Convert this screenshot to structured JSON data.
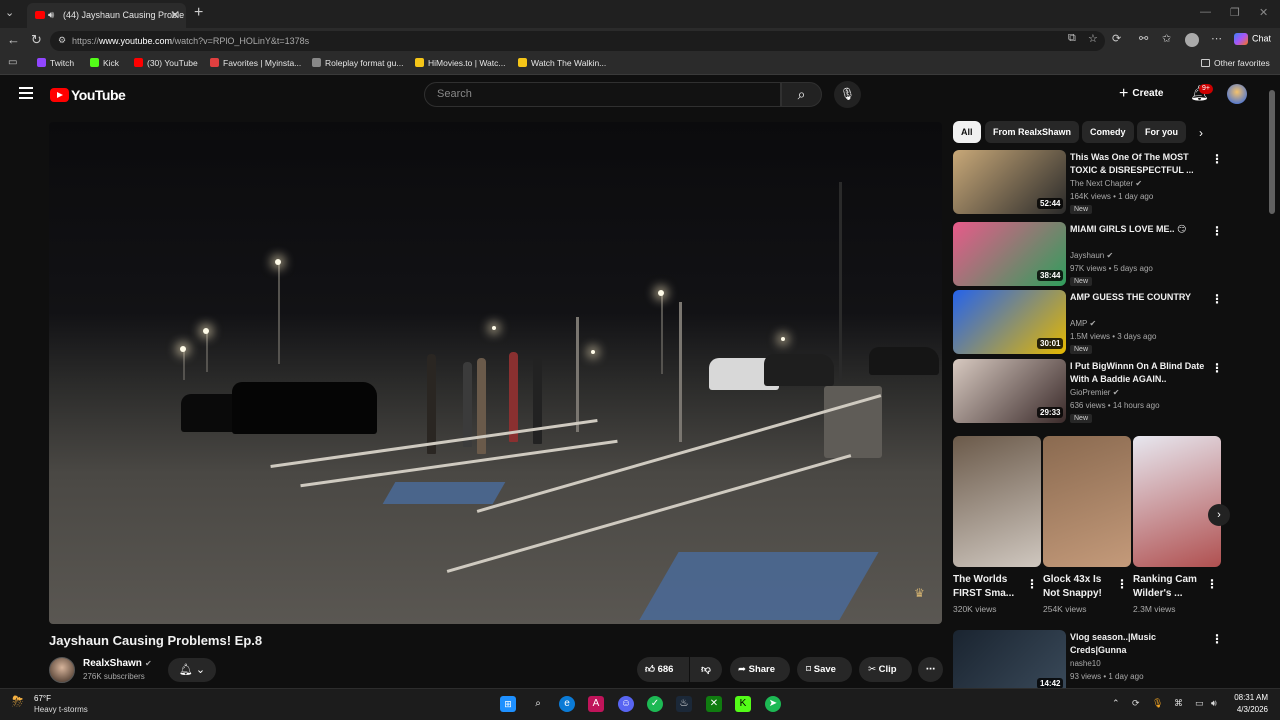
{
  "browser": {
    "tab_title": "(44) Jayshaun Causing Proble",
    "url_prefix": "https://",
    "url_host": "www.youtube.com",
    "url_path": "/watch?v=RPlO_HOLinY&t=1378s",
    "chat_label": "Chat",
    "bookmarks": [
      {
        "label": "Twitch",
        "color": "#9146ff"
      },
      {
        "label": "Kick",
        "color": "#53fc18"
      },
      {
        "label": "(30) YouTube",
        "color": "#ff0000"
      },
      {
        "label": "Favorites | Myinsta...",
        "color": "#e04040"
      },
      {
        "label": "Roleplay format gu...",
        "color": "#888888"
      },
      {
        "label": "HiMovies.to | Watc...",
        "color": "#f5c518"
      },
      {
        "label": "Watch The Walkin...",
        "color": "#f5c518"
      }
    ],
    "other_favorites": "Other favorites"
  },
  "youtube": {
    "logo_text": "YouTube",
    "search_placeholder": "Search",
    "create_label": "Create",
    "notification_count": "9+"
  },
  "video": {
    "title": "Jayshaun Causing Problems! Ep.8",
    "channel_name": "RealxShawn",
    "subscribers": "276K subscribers",
    "likes": "686",
    "share_label": "Share",
    "save_label": "Save",
    "clip_label": "Clip"
  },
  "sidebar": {
    "chips": [
      "All",
      "From RealxShawn",
      "Comedy",
      "For you"
    ],
    "recommendations": [
      {
        "title": "This Was One Of The MOST TOXIC & DISRESPECTFUL ...",
        "channel": "The Next Chapter",
        "meta": "164K views • 1 day ago",
        "badge": "New",
        "duration": "52:44",
        "thumb_colors": [
          "#c8a878",
          "#2a2a2a"
        ]
      },
      {
        "title": "MIAMI GIRLS LOVE ME.. 😏",
        "channel": "Jayshaun",
        "meta": "97K views • 5 days ago",
        "badge": "New",
        "duration": "38:44",
        "thumb_colors": [
          "#e85a8a",
          "#2f9e5c"
        ]
      },
      {
        "title": "AMP GUESS THE COUNTRY",
        "channel": "AMP",
        "meta": "1.5M views • 3 days ago",
        "badge": "New",
        "duration": "30:01",
        "thumb_colors": [
          "#2563eb",
          "#e5b800"
        ]
      },
      {
        "title": "I Put BigWinnn On A Blind Date With A Baddie AGAIN..",
        "channel": "GioPremier",
        "meta": "636 views • 14 hours ago",
        "badge": "New",
        "duration": "29:33",
        "thumb_colors": [
          "#d7c9c0",
          "#3a2a2a"
        ]
      }
    ],
    "shorts": [
      {
        "title": "The Worlds FIRST Sma...",
        "views": "320K views",
        "colors": [
          "#6b5a4a",
          "#cfc7bf"
        ]
      },
      {
        "title": "Glock 43x Is Not Snappy!",
        "views": "254K views",
        "colors": [
          "#8a6a50",
          "#c49a7a"
        ]
      },
      {
        "title": "Ranking Cam Wilder's ...",
        "views": "2.3M views",
        "colors": [
          "#e7e7ef",
          "#b05050"
        ]
      }
    ],
    "last_rec": {
      "title": "Vlog season..|Music Creds|Gunna",
      "channel": "nashe10",
      "meta": "93 views • 1 day ago",
      "duration": "14:42"
    }
  },
  "taskbar": {
    "temperature": "67°F",
    "weather": "Heavy t-storms",
    "time": "08:31 AM",
    "date": "4/3/2026"
  }
}
